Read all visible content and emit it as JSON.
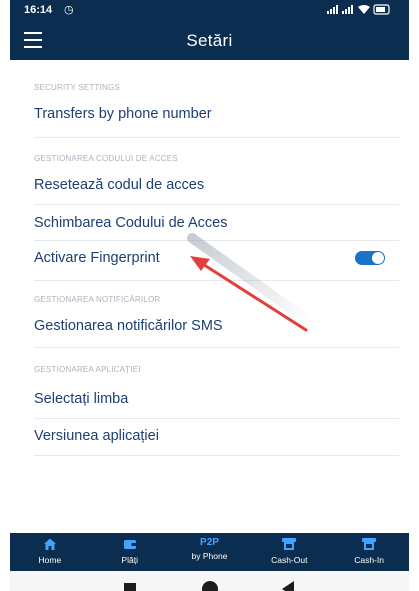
{
  "status_bar": {
    "time": "16:14",
    "alarm_icon": "alarm-clock-icon",
    "indicators": "signal signal wifi battery"
  },
  "header": {
    "menu_icon": "hamburger-menu-icon",
    "title": "Setări"
  },
  "sections": [
    {
      "header": "SECURITY SETTINGS",
      "items": [
        "Transfers by phone number"
      ]
    },
    {
      "header": "GESTIONAREA CODULUI DE ACCES",
      "items": [
        "Resetează codul de acces",
        "Schimbarea Codului de Acces",
        "Activare Fingerprint"
      ]
    },
    {
      "header": "GESTIONAREA NOTIFICĂRILOR",
      "items": [
        "Gestionarea notificărilor SMS"
      ]
    },
    {
      "header": "GESTIONAREA APLICAȚIEI",
      "items": [
        "Selectați limba",
        "Versiunea aplicației"
      ]
    }
  ],
  "fingerprint_toggle": {
    "state": "on",
    "color": "#1a73c7"
  },
  "annotation": {
    "type": "red-arrow",
    "color": "#e04038"
  },
  "bottom_nav": [
    {
      "icon": "home-icon",
      "label": "Home"
    },
    {
      "icon": "wallet-icon",
      "label": "Plăți"
    },
    {
      "icon": "p2p-icon",
      "top": "P2P",
      "label": "by Phone"
    },
    {
      "icon": "atm-icon",
      "label": "Cash-Out"
    },
    {
      "icon": "atm-icon",
      "label": "Cash-In"
    }
  ],
  "system_nav": [
    "recents-icon",
    "home-circle-icon",
    "back-triangle-icon"
  ],
  "colors": {
    "primary": "#0b2d4f",
    "link_text": "#1d3f73",
    "section_header": "#a8b3bd",
    "accent": "#43a3ff"
  }
}
